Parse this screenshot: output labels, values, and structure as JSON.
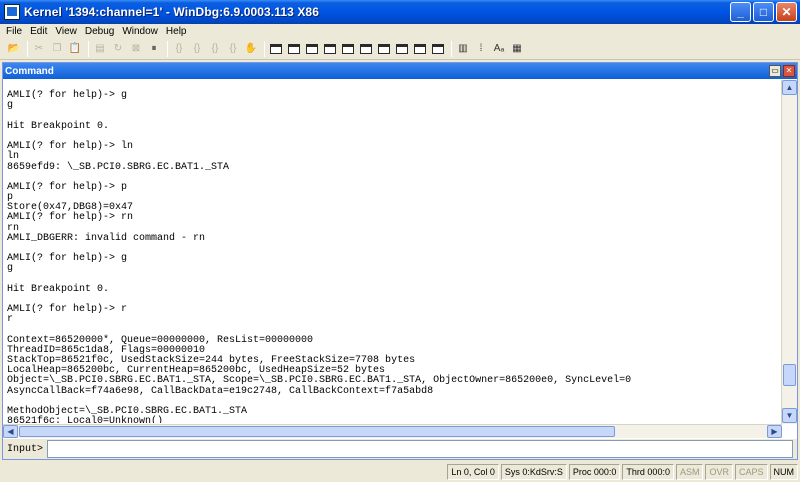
{
  "window": {
    "title": "Kernel '1394:channel=1' - WinDbg:6.9.0003.113 X86"
  },
  "menu": [
    "File",
    "Edit",
    "View",
    "Debug",
    "Window",
    "Help"
  ],
  "command_window": {
    "title": "Command",
    "lines": [
      "",
      "AMLI(? for help)-> g",
      "g",
      "",
      "Hit Breakpoint 0.",
      "",
      "AMLI(? for help)-> ln",
      "ln",
      "8659efd9: \\_SB.PCI0.SBRG.EC.BAT1._STA",
      "",
      "AMLI(? for help)-> p",
      "p",
      "Store(0x47,DBG8)=0x47",
      "AMLI(? for help)-> rn",
      "rn",
      "AMLI_DBGERR: invalid command - rn",
      "",
      "AMLI(? for help)-> g",
      "g",
      "",
      "Hit Breakpoint 0.",
      "",
      "AMLI(? for help)-> r",
      "r",
      "",
      "Context=86520000*, Queue=00000000, ResList=00000000",
      "ThreadID=865c1da8, Flags=00000010",
      "StackTop=86521f0c, UsedStackSize=244 bytes, FreeStackSize=7708 bytes",
      "LocalHeap=865200bc, CurrentHeap=865200bc, UsedHeapSize=52 bytes",
      "Object=\\_SB.PCI0.SBRG.EC.BAT1._STA, Scope=\\_SB.PCI0.SBRG.EC.BAT1._STA, ObjectOwner=865200e0, SyncLevel=0",
      "AsyncCallBack=f74a6e98, CallBackData=e19c2748, CallBackContext=f7a5abd8",
      "",
      "MethodObject=\\_SB.PCI0.SBRG.EC.BAT1._STA",
      "86521f6c: Local0=Unknown()"
    ],
    "input_label": "Input>",
    "input_value": ""
  },
  "status": {
    "ln_col": "Ln 0, Col 0",
    "sys": "Sys 0:KdSrv:S",
    "proc": "Proc 000:0",
    "thrd": "Thrd 000:0",
    "asm": "ASM",
    "ovr": "OVR",
    "caps": "CAPS",
    "num": "NUM"
  }
}
